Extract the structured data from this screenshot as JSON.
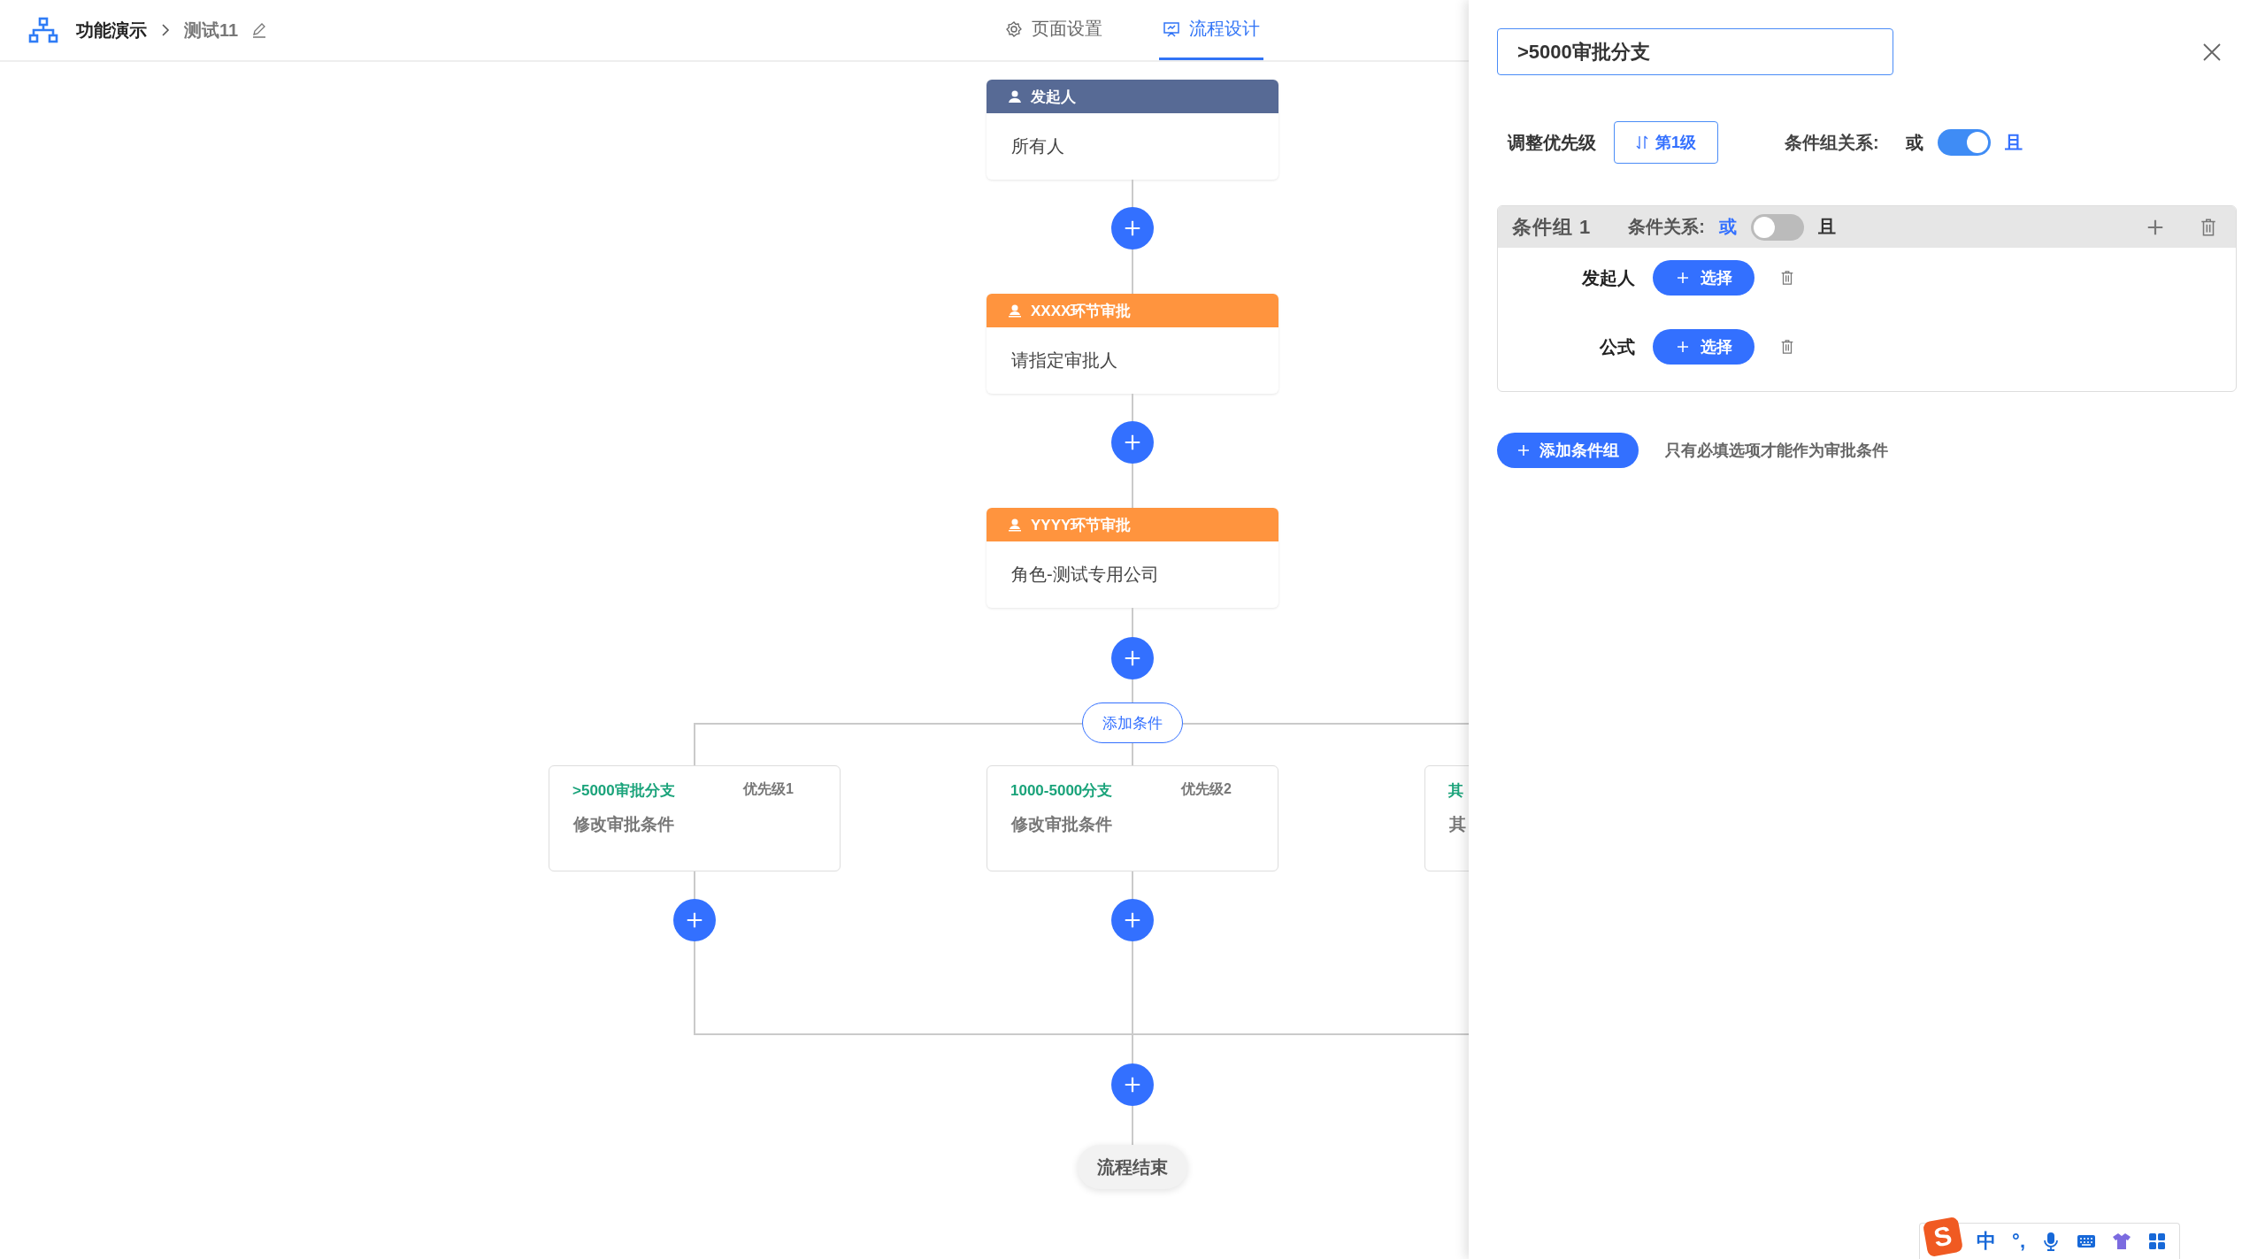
{
  "header": {
    "app_title": "功能演示",
    "page_name": "测试11"
  },
  "tabs": [
    {
      "label": "页面设置",
      "selected": false
    },
    {
      "label": "流程设计",
      "selected": true
    }
  ],
  "flow": {
    "nodes": [
      {
        "kind": "start",
        "title": "发起人",
        "content": "所有人"
      },
      {
        "kind": "approver",
        "title": "XXXX环节审批",
        "content": "请指定审批人"
      },
      {
        "kind": "approver",
        "title": "YYYY环节审批",
        "content": "角色-测试专用公司"
      }
    ],
    "add_condition": "添加条件",
    "branches": [
      {
        "name": ">5000审批分支",
        "priority": "优先级1",
        "content": "修改审批条件"
      },
      {
        "name": "1000-5000分支",
        "priority": "优先级2",
        "content": "修改审批条件"
      },
      {
        "name": "其",
        "content": "其"
      }
    ],
    "end": "流程结束"
  },
  "panel": {
    "name_value": ">5000审批分支",
    "priority_label": "调整优先级",
    "priority_button": "第1级",
    "group_relation": {
      "label": "条件组关系:",
      "off_label": "或",
      "on_label": "且",
      "on": true
    },
    "groups": [
      {
        "title": "条件组 1",
        "relation": {
          "label": "条件关系:",
          "off_label": "或",
          "on_label": "且",
          "on": false
        },
        "conditions": [
          {
            "label": "发起人",
            "button": "选择"
          },
          {
            "label": "公式",
            "button": "选择"
          }
        ]
      }
    ],
    "add_group_button": "添加条件组",
    "hint": "只有必填选项才能作为审批条件"
  },
  "ime": {
    "logo": "S",
    "mode": "中",
    "punctuation": "°,"
  }
}
